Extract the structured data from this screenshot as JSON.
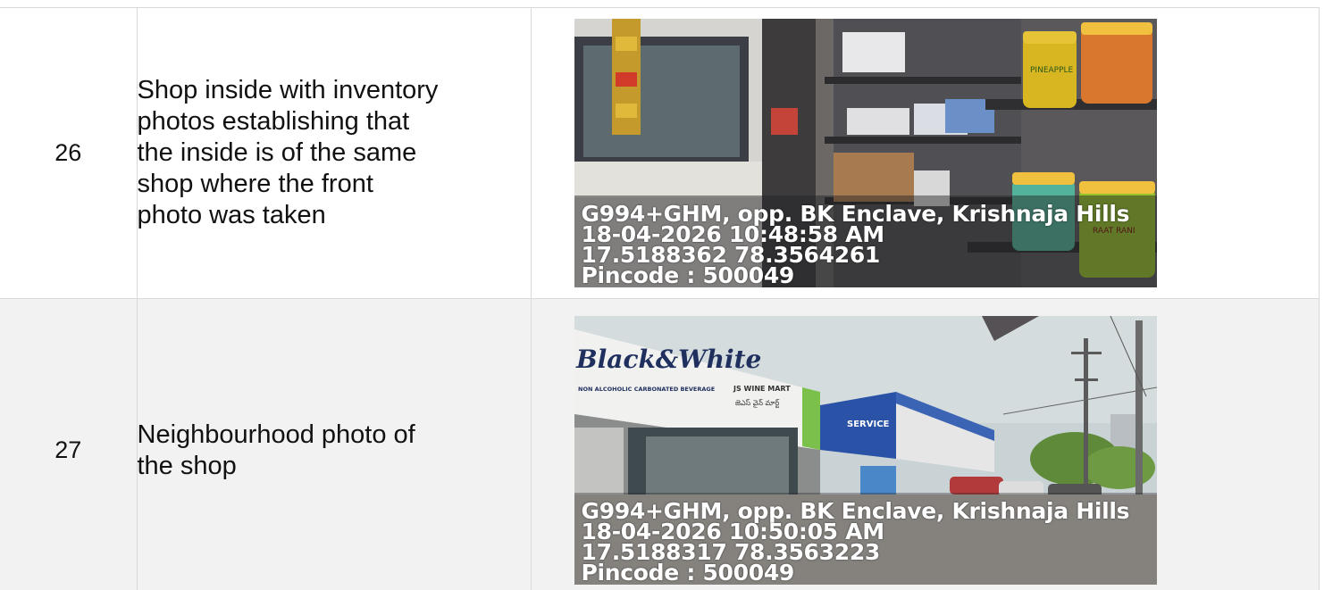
{
  "rows": [
    {
      "number": "26",
      "description_lines": [
        "Shop inside with inventory",
        "photos establishing that",
        "the inside is of the same",
        "shop where the front",
        "photo was taken"
      ],
      "photo": {
        "signage": [
          "PINEAPPLE",
          "RAAT RANI"
        ],
        "stamp": [
          "G994+GHM, opp. BK Enclave, Krishnaja Hills",
          "18-04-2026 10:48:58 AM",
          "17.5188362 78.3564261",
          "Pincode : 500049"
        ]
      }
    },
    {
      "number": "27",
      "description_lines": [
        "Neighbourhood photo of",
        "the shop"
      ],
      "photo": {
        "signage": [
          "Black&White",
          "NON ALCOHOLIC CARBONATED BEVERAGE",
          "JS WINE MART",
          "జెఎస్ వైన్ మార్ట్",
          "SERVICE"
        ],
        "stamp": [
          "G994+GHM, opp. BK Enclave, Krishnaja Hills",
          "18-04-2026 10:50:05 AM",
          "17.5188317 78.3563223",
          "Pincode : 500049"
        ]
      }
    }
  ],
  "colors": {
    "border": "#d9d9d9",
    "alt_row_bg": "#f2f2f2",
    "stamp_text": "#ffffff"
  }
}
